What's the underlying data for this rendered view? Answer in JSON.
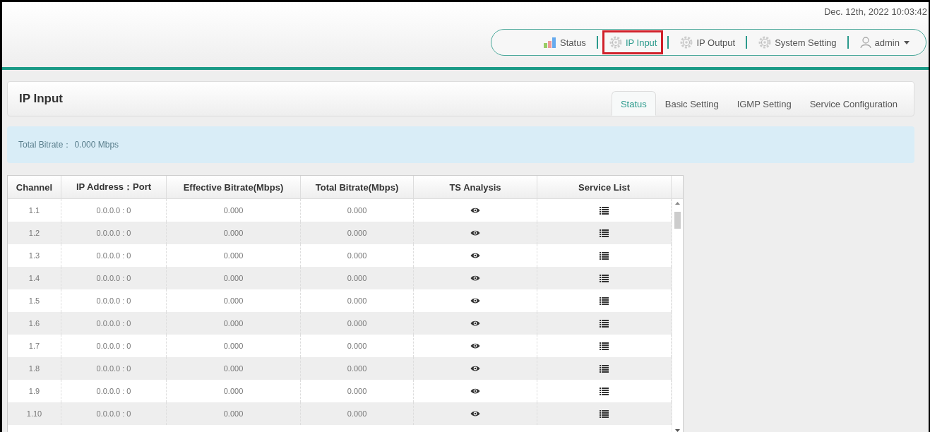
{
  "header": {
    "datetime": "Dec. 12th, 2022 10:03:42",
    "nav": [
      {
        "kind": "chart",
        "label": "Status",
        "selected": false
      },
      {
        "kind": "gear",
        "label": "IP Input",
        "selected": true
      },
      {
        "kind": "gear",
        "label": "IP Output",
        "selected": false
      },
      {
        "kind": "gear",
        "label": "System Setting",
        "selected": false
      },
      {
        "kind": "user",
        "label": "admin",
        "selected": false
      }
    ]
  },
  "panel": {
    "title": "IP Input",
    "tabs": [
      {
        "label": "Status",
        "selected": true
      },
      {
        "label": "Basic Setting",
        "selected": false
      },
      {
        "label": "IGMP Setting",
        "selected": false
      },
      {
        "label": "Service Configuration",
        "selected": false
      }
    ],
    "summary": {
      "label": "Total Bitrate：",
      "value": "0.000 Mbps"
    }
  },
  "table": {
    "columns": [
      "Channel",
      "IP Address：Port",
      "Effective Bitrate(Mbps)",
      "Total Bitrate(Mbps)",
      "TS Analysis",
      "Service List"
    ],
    "rows": [
      {
        "channel": "1.1",
        "address": "0.0.0.0 : 0",
        "effective": "0.000",
        "total": "0.000"
      },
      {
        "channel": "1.2",
        "address": "0.0.0.0 : 0",
        "effective": "0.000",
        "total": "0.000"
      },
      {
        "channel": "1.3",
        "address": "0.0.0.0 : 0",
        "effective": "0.000",
        "total": "0.000"
      },
      {
        "channel": "1.4",
        "address": "0.0.0.0 : 0",
        "effective": "0.000",
        "total": "0.000"
      },
      {
        "channel": "1.5",
        "address": "0.0.0.0 : 0",
        "effective": "0.000",
        "total": "0.000"
      },
      {
        "channel": "1.6",
        "address": "0.0.0.0 : 0",
        "effective": "0.000",
        "total": "0.000"
      },
      {
        "channel": "1.7",
        "address": "0.0.0.0 : 0",
        "effective": "0.000",
        "total": "0.000"
      },
      {
        "channel": "1.8",
        "address": "0.0.0.0 : 0",
        "effective": "0.000",
        "total": "0.000"
      },
      {
        "channel": "1.9",
        "address": "0.0.0.0 : 0",
        "effective": "0.000",
        "total": "0.000"
      },
      {
        "channel": "1.10",
        "address": "0.0.0.0 : 0",
        "effective": "0.000",
        "total": "0.000"
      }
    ]
  }
}
